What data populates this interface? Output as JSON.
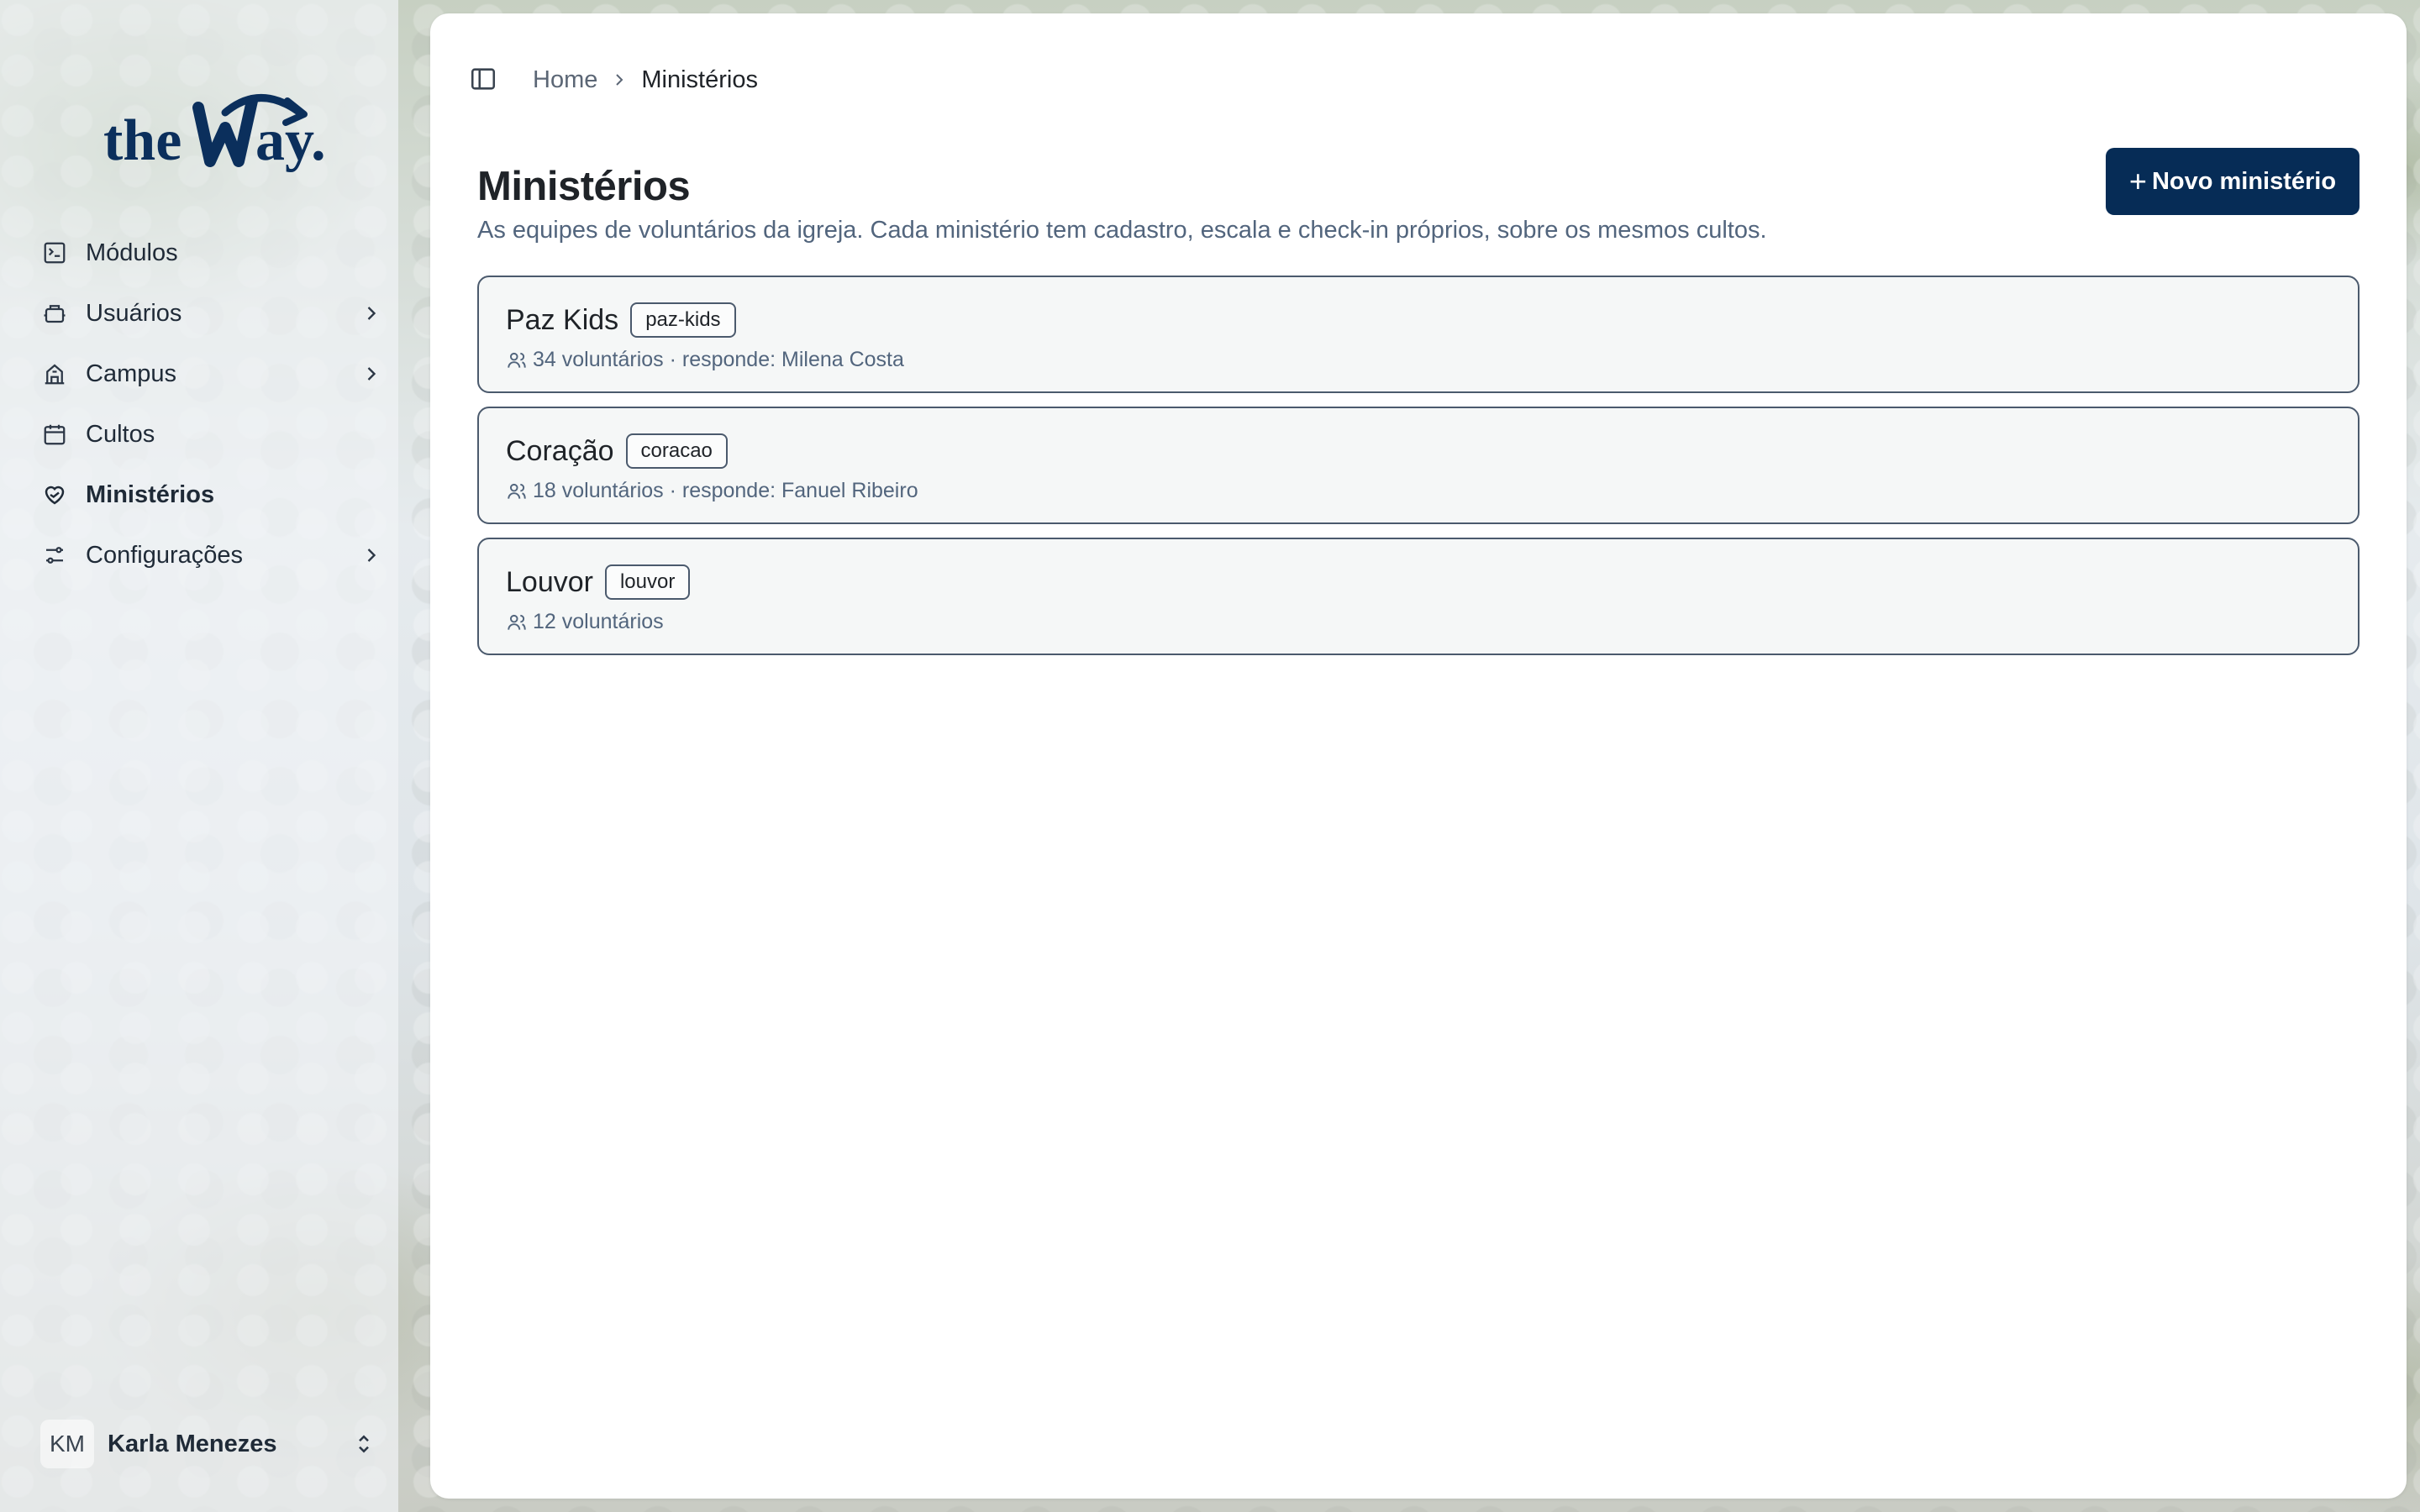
{
  "app": {
    "logo_text": "theWay."
  },
  "sidebar": {
    "items": [
      {
        "label": "Módulos",
        "icon": "modules-icon",
        "has_children": false
      },
      {
        "label": "Usuários",
        "icon": "users-icon",
        "has_children": true
      },
      {
        "label": "Campus",
        "icon": "campus-icon",
        "has_children": true
      },
      {
        "label": "Cultos",
        "icon": "calendar-icon",
        "has_children": false
      },
      {
        "label": "Ministérios",
        "icon": "ministry-heart-icon",
        "has_children": false,
        "active": true
      },
      {
        "label": "Configurações",
        "icon": "settings-sliders-icon",
        "has_children": true
      }
    ],
    "user": {
      "initials": "KM",
      "name": "Karla Menezes"
    }
  },
  "breadcrumb": {
    "home": "Home",
    "current": "Ministérios"
  },
  "page": {
    "title": "Ministérios",
    "subtitle": "As equipes de voluntários da igreja. Cada ministério tem cadastro, escala e check-in próprios, sobre os mesmos cultos.",
    "new_button_label": "Novo ministério"
  },
  "ministries": [
    {
      "name": "Paz Kids",
      "slug": "paz-kids",
      "meta": "34 voluntários · responde: Milena Costa"
    },
    {
      "name": "Coração",
      "slug": "coracao",
      "meta": "18 voluntários · responde: Fanuel Ribeiro"
    },
    {
      "name": "Louvor",
      "slug": "louvor",
      "meta": "12 voluntários"
    }
  ],
  "colors": {
    "primary": "#062c56",
    "logo": "#0b2f5c",
    "text_muted": "#52657d",
    "card_border": "#4b5a6d"
  }
}
